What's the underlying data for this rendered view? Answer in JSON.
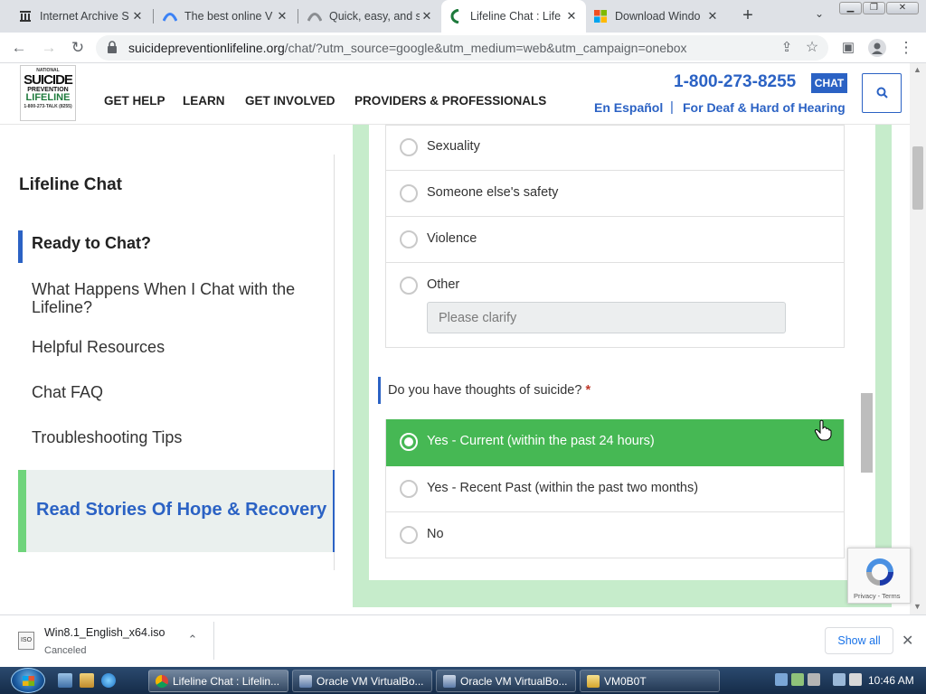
{
  "browser": {
    "tabs": [
      {
        "title": "Internet Archive S",
        "icon": "archive-icon"
      },
      {
        "title": "The best online V",
        "icon": "vpn-icon"
      },
      {
        "title": "Quick, easy, and s",
        "icon": "globe-icon"
      },
      {
        "title": "Lifeline Chat : Life",
        "icon": "lifeline-icon"
      },
      {
        "title": "Download Windo",
        "icon": "windows-icon"
      }
    ],
    "url_host": "suicidepreventionlifeline.org",
    "url_rest": "/chat/?utm_source=google&utm_medium=web&utm_campaign=onebox"
  },
  "site": {
    "logo": {
      "line1": "NATIONAL",
      "line2": "SUICIDE",
      "line3": "PREVENTION",
      "line4": "LIFELINE",
      "line5": "1-800-273-TALK (8255)"
    },
    "nav": [
      "GET HELP",
      "LEARN",
      "GET INVOLVED",
      "PROVIDERS & PROFESSIONALS"
    ],
    "phone": "1-800-273-8255",
    "chat_badge": "CHAT",
    "espanol": "En Español",
    "separator": "|",
    "deaf": "For Deaf & Hard of Hearing"
  },
  "sidebar": {
    "title": "Lifeline Chat",
    "items": [
      "Ready to Chat?",
      "What Happens When I Chat with the Lifeline?",
      "Helpful Resources",
      "Chat FAQ",
      "Troubleshooting Tips"
    ],
    "stories": "Read Stories Of Hope & Recovery"
  },
  "form": {
    "topic_options": [
      "Sexuality",
      "Someone else's safety",
      "Violence",
      "Other"
    ],
    "clarify_placeholder": "Please clarify",
    "question": "Do you have thoughts of suicide?",
    "required_mark": "*",
    "answers": [
      "Yes - Current (within the past 24 hours)",
      "Yes - Recent Past (within the past two months)",
      "No"
    ],
    "selected_answer_index": 0
  },
  "recaptcha": {
    "terms": "Privacy - Terms"
  },
  "downloads": {
    "filename": "Win8.1_English_x64.iso",
    "status": "Canceled",
    "icon_label": "ISO",
    "show_all": "Show all"
  },
  "taskbar": {
    "buttons": [
      "Lifeline Chat : Lifelin...",
      "Oracle VM VirtualBo...",
      "Oracle VM VirtualBo...",
      "VM0B0T"
    ],
    "clock": "10:46 AM"
  },
  "colors": {
    "brand_blue": "#2b62c4",
    "selected_green": "#46b854",
    "form_bg_green": "#c6eccb",
    "stories_green": "#6fd47b"
  }
}
